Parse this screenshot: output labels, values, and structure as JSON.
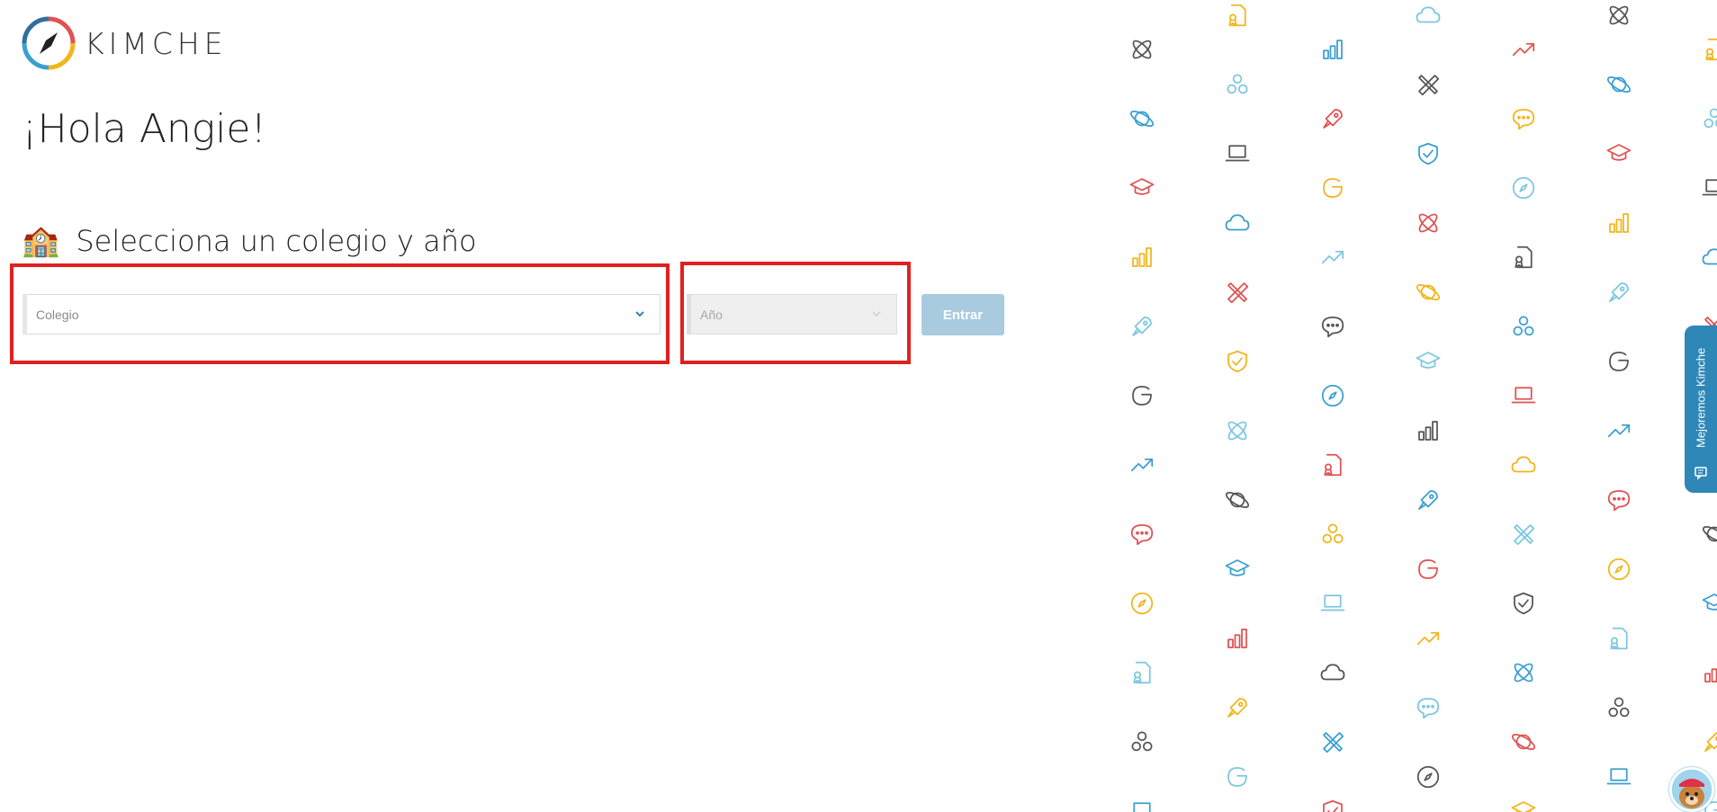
{
  "brand": {
    "name": "KIMCHE",
    "logo_icon": "compass-icon"
  },
  "greeting": "¡Hola Angie!",
  "section": {
    "emoji": "🏫",
    "title": "Selecciona un colegio y año"
  },
  "form": {
    "school_placeholder": "Colegio",
    "year_placeholder": "Año",
    "submit_label": "Entrar"
  },
  "feedback": {
    "label": "Mejoremos Kimche",
    "icon": "comment-icon"
  },
  "colors": {
    "highlight": "#e02020",
    "button": "#a8cbe0",
    "feedback_tab": "#2f87b7",
    "icon_palette": [
      "#555555",
      "#3a9fd1",
      "#e05252",
      "#f2b51a",
      "#7cc7e0"
    ]
  },
  "background_icons": [
    "atom",
    "graduation-cap",
    "rocket",
    "trending-up",
    "compass",
    "people",
    "cloud",
    "shield",
    "planet",
    "bar-chart",
    "google",
    "chat",
    "certificate",
    "laptop",
    "pencil-ruler"
  ]
}
